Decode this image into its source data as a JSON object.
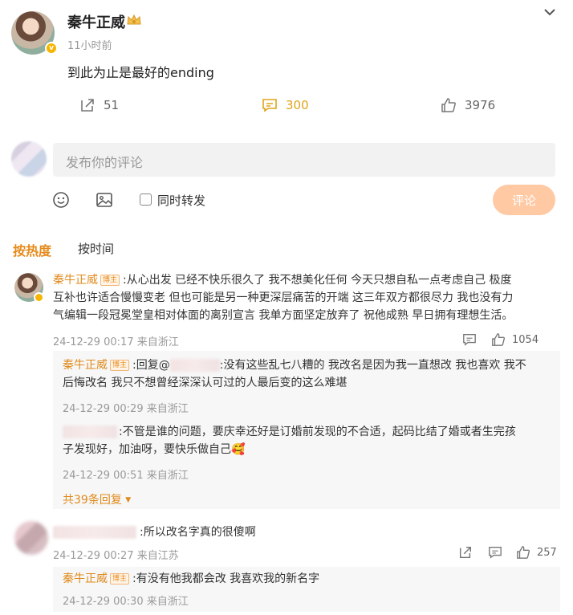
{
  "post": {
    "author": "秦牛正威",
    "time": "11小时前",
    "text": "到此为止是最好的ending",
    "reposts": "51",
    "comments": "300",
    "likes": "3976"
  },
  "composer": {
    "placeholder": "发布你的评论",
    "repost_label": "同时转发",
    "submit_label": "评论"
  },
  "sort": {
    "hot": "按热度",
    "time": "按时间"
  },
  "badge": "博主",
  "comments": [
    {
      "author": "秦牛正威",
      "text_line1": ":从心出发 已经不快乐很久了 我不想美化任何 今天只想自私一点考虑自己 极度",
      "text_line2": "互补也许适合慢慢变老 但也可能是另一种更深层痛苦的开端 这三年双方都很尽力 我也没有力",
      "text_line3": "气编辑一段冠冕堂皇相对体面的离别宣言 我单方面坚定放弃了 祝他成熟 早日拥有理想生活。",
      "meta": "24-12-29 00:17 来自浙江",
      "likes": "1054",
      "replies": [
        {
          "author": "秦牛正威",
          "prefix": ":回复@",
          "text_line1": ":没有这些乱七八糟的 我改名是因为我一直想改 我也喜欢 我不",
          "text_line2": "后悔改名 我只不想曾经深深认可过的人最后变的这么难堪",
          "meta": "24-12-29 00:29 来自浙江"
        },
        {
          "text_line1": ":不管是谁的问题，要庆幸还好是订婚前发现的不合适，起码比结了婚或者生完孩",
          "text_line2": "子发现好，加油呀，要快乐做自己",
          "emoji": "🥰",
          "meta": "24-12-29 00:51 来自浙江"
        }
      ],
      "more_replies": "共39条回复"
    },
    {
      "text": ":所以改名字真的很傻啊",
      "meta": "24-12-29 00:27 来自江苏",
      "likes": "257",
      "replies": [
        {
          "author": "秦牛正威",
          "text": ":有没有他我都会改 我喜欢我的新名字",
          "meta": "24-12-29 00:30 来自浙江"
        }
      ]
    }
  ]
}
